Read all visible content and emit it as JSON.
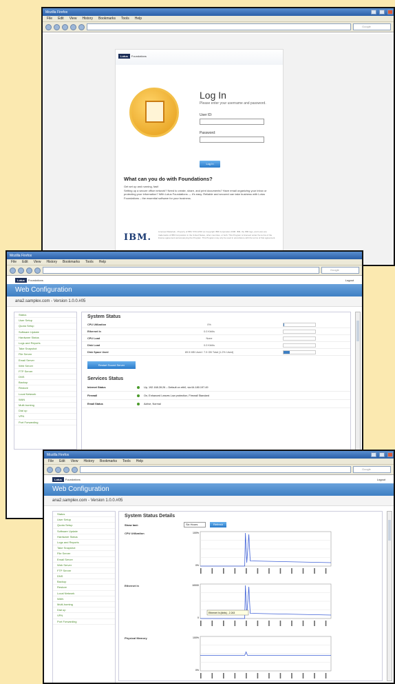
{
  "browser": {
    "title": "Mozilla Firefox",
    "menu": [
      "File",
      "Edit",
      "View",
      "History",
      "Bookmarks",
      "Tools",
      "Help"
    ],
    "search_placeholder": "Google"
  },
  "login": {
    "brand": "Lotus",
    "brand_suffix": "Foundations",
    "title": "Log In",
    "subtitle": "Please enter your username and password.",
    "user_label": "User ID:",
    "password_label": "Password:",
    "login_button": "Log In",
    "what_title": "What can you do with Foundations?",
    "what_body_1": "Get set up and running, fast!",
    "what_body_2": "Setting up a secure office network? Need to create, share, and print documents? Have email organizing your inbox or protecting your information? With Lotus Foundations — it's easy. Reliable and secured can take business with Lotus Foundations – the essential software for your business.",
    "ibm": "IBM.",
    "legal": "Licensed Materials - Property of IBM. 5724-W16 (c) Copyright IBM Corporation 2008. IBM, the IBM logo, and Lotus are trademarks of IBM Corporation in the United States, other countries, or both. This Program is licensed under the terms of the license agreement accompanying the Program. This Program may only be used in accordance with the terms of that agreement."
  },
  "app": {
    "brand": "Lotus",
    "brand_suffix": "Foundations",
    "logout": "Logout",
    "banner": "Web Configuration",
    "host": "ana2.samplex.com - Version 1.0.0.#05"
  },
  "nav_items": [
    "Status",
    "User Setup",
    "Quota Setup",
    "Software Update",
    "Hardware Status",
    "Logs and Reports",
    "Take Snapshot",
    "File Server",
    "Email Server",
    "Web Server",
    "FTP Server",
    "DNS",
    "Backup",
    "Restore",
    "Local Network",
    "WAN",
    "Multi-homing",
    "Dial up",
    "VPN",
    "Port Forwarding"
  ],
  "nav_items_w3": [
    "Status",
    "User Setup",
    "Quota Setup",
    "Software Update",
    "Hardware Status",
    "Logs and Reports",
    "Take Snapshot",
    "File Server",
    "Email Server",
    "Web Server",
    "FTP Server",
    "DNS",
    "Backup",
    "Restore",
    "Local Network",
    "WAN",
    "Multi-homing",
    "Dial up",
    "VPN",
    "Port Forwarding"
  ],
  "system_status": {
    "title": "System Status",
    "rows": [
      {
        "label": "CPU Utilization",
        "value": "0%",
        "pct": 0.02
      },
      {
        "label": "Ethernet In",
        "value": "0.0 Kbit/s",
        "pct": 0
      },
      {
        "label": "CPU Load",
        "value": "None",
        "pct": 0
      },
      {
        "label": "Disk Load",
        "value": "0.0 Kbit/s",
        "pct": 0
      },
      {
        "label": "Disk Space Used",
        "value": "89.5 MB Used / 7.5 GB Total (1.2% Used)",
        "pct": 0.2
      }
    ],
    "restart_button": "Restart Sound Server"
  },
  "services": {
    "title": "Services Status",
    "rows": [
      {
        "label": "Internet Status",
        "value": "Up, 192.168.28.26 – Default on eth0, via 64.180.197.49"
      },
      {
        "label": "Firewall",
        "value": "On, Enhanced Leaves Low protection, Firewall Standard"
      },
      {
        "label": "Email Status",
        "value": "Active, Normal"
      }
    ]
  },
  "details": {
    "title": "System Status Details",
    "show_label": "Show last:",
    "show_value": "Six Hours",
    "refresh": "Refresh",
    "charts": [
      {
        "label": "CPU Utilization",
        "ymax": "100%",
        "ymin": "0%"
      },
      {
        "label": "Ethernet In",
        "ymax": "10000",
        "ymin": "0",
        "tooltip": "Ethernet In (kbits) - 2.243"
      },
      {
        "label": "Physical Memory",
        "ymax": "100%",
        "ymin": "0%"
      }
    ]
  }
}
